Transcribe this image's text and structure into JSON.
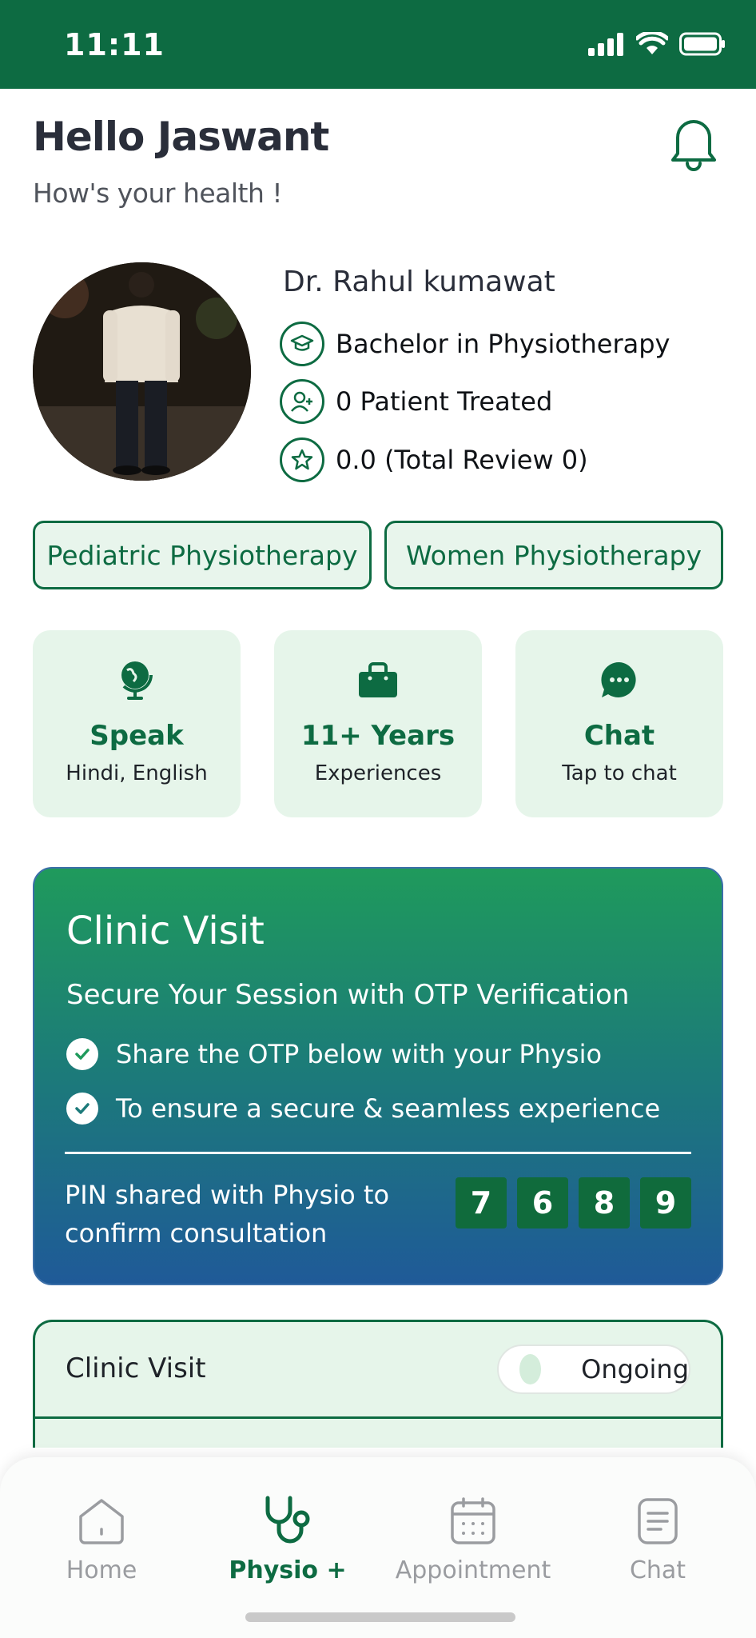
{
  "status_bar": {
    "time": "11:11"
  },
  "header": {
    "greeting": "Hello Jaswant",
    "subtitle": "How's your health !",
    "bell_icon": "bell-icon"
  },
  "doctor": {
    "name": "Dr. Rahul kumawat",
    "qualification": "Bachelor in Physiotherapy",
    "patients": "0 Patient Treated",
    "reviews": "0.0 (Total Review 0)"
  },
  "specialties": [
    "Pediatric Physiotherapy",
    "Women Physiotherapy"
  ],
  "features": [
    {
      "title": "Speak",
      "subtitle": "Hindi, English",
      "icon": "globe-icon"
    },
    {
      "title": "11+ Years",
      "subtitle": "Experiences",
      "icon": "briefcase-icon"
    },
    {
      "title": "Chat",
      "subtitle": "Tap to chat",
      "icon": "chat-icon"
    }
  ],
  "otp_card": {
    "title": "Clinic Visit",
    "subtitle": "Secure Your Session with OTP Verification",
    "checks": [
      "Share the OTP below with your Physio",
      "To ensure a secure & seamless experience"
    ],
    "pin_text": "PIN shared with Physio to confirm consultation",
    "digits": [
      "7",
      "6",
      "8",
      "9"
    ]
  },
  "visit_card": {
    "label": "Clinic Visit",
    "status": "Ongoing"
  },
  "nav": {
    "items": [
      {
        "label": "Home",
        "icon": "home-icon"
      },
      {
        "label": "Physio +",
        "icon": "stethoscope-icon"
      },
      {
        "label": "Appointment",
        "icon": "calendar-icon"
      },
      {
        "label": "Chat",
        "icon": "document-icon"
      }
    ],
    "active": "Physio +"
  },
  "colors": {
    "brand": "#0d6b42",
    "card_bg": "#e6f5ea"
  }
}
